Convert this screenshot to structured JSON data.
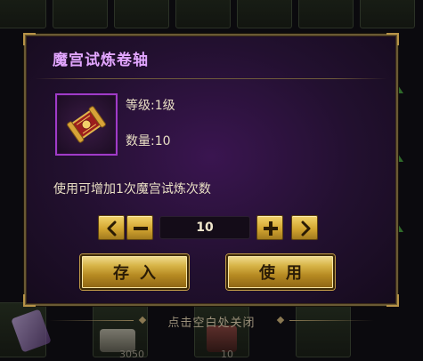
{
  "dialog": {
    "title": "魔宫试炼卷轴",
    "item": {
      "icon": "scroll-icon",
      "level_label": "等级:",
      "level_value": "1级",
      "quantity_label": "数量:",
      "quantity_value": "10"
    },
    "description": "使用可增加1次魔宫试炼次数",
    "selector": {
      "value": "10",
      "decrease_max_icon": "chevron-left-icon",
      "decrease_icon": "minus-icon",
      "increase_icon": "plus-icon",
      "increase_max_icon": "chevron-right-icon"
    },
    "store_button": "存入",
    "use_button": "使用",
    "close_hint": "点击空白处关闭"
  },
  "background": {
    "counts": [
      "3050",
      "10"
    ]
  },
  "colors": {
    "title": "#e2a6ff",
    "dialog_border": "#6a5a34",
    "gold_button": "#d7b447",
    "item_slot_border": "#a03bc8"
  }
}
